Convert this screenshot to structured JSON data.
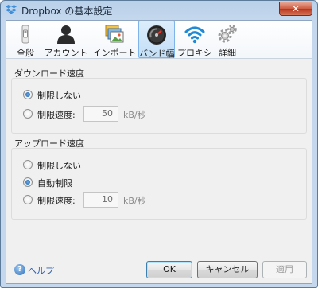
{
  "window": {
    "title": "Dropbox の基本設定",
    "close_glyph": "✕"
  },
  "tabs": [
    {
      "label": "全般",
      "icon": "light-switch-icon",
      "active": false
    },
    {
      "label": "アカウント",
      "icon": "user-silhouette-icon",
      "active": false
    },
    {
      "label": "インポート",
      "icon": "photos-icon",
      "active": false
    },
    {
      "label": "バンド幅",
      "icon": "speedometer-icon",
      "active": true
    },
    {
      "label": "プロキシ",
      "icon": "wifi-icon",
      "active": false
    },
    {
      "label": "詳細",
      "icon": "gears-icon",
      "active": false
    }
  ],
  "download": {
    "title": "ダウンロード速度",
    "options": [
      {
        "label": "制限しない",
        "selected": true
      },
      {
        "label": "制限速度:",
        "selected": false
      }
    ],
    "limit_value": "50",
    "unit": "kB/秒"
  },
  "upload": {
    "title": "アップロード速度",
    "options": [
      {
        "label": "制限しない",
        "selected": false
      },
      {
        "label": "自動制限",
        "selected": true
      },
      {
        "label": "制限速度:",
        "selected": false
      }
    ],
    "limit_value": "10",
    "unit": "kB/秒"
  },
  "footer": {
    "help_label": "ヘルプ",
    "help_glyph": "?",
    "ok_label": "OK",
    "cancel_label": "キャンセル",
    "apply_label": "適用"
  },
  "colors": {
    "accent": "#1b5fa8",
    "link": "#2d63b5",
    "active_tab": "#c4dff6"
  }
}
